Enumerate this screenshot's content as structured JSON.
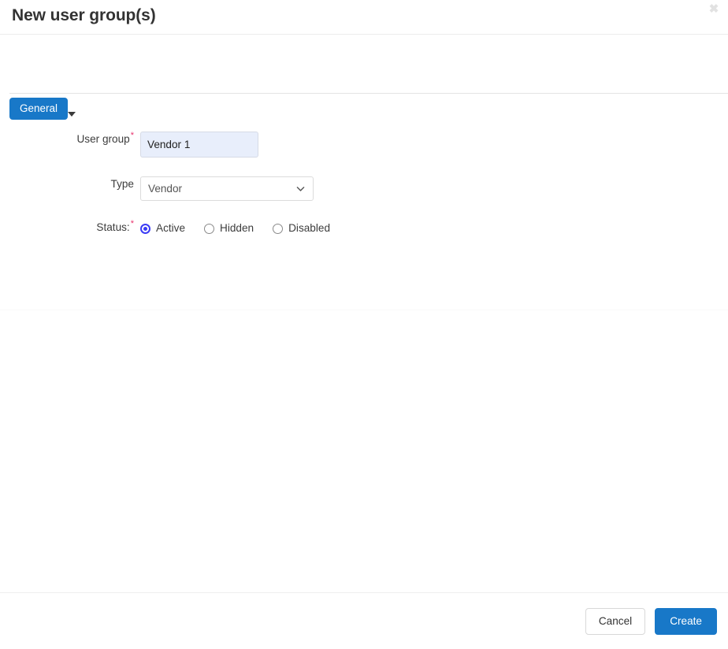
{
  "dialog": {
    "title": "New user group(s)",
    "close_label": "✖"
  },
  "tabs": [
    {
      "label": "General",
      "active": true
    }
  ],
  "section": {
    "title": "General",
    "collapsed": false
  },
  "form": {
    "fields": [
      {
        "label": "User group",
        "required": true,
        "required_mark": "*",
        "type": "text",
        "value": "Vendor 1",
        "placeholder": ""
      },
      {
        "label": "Type",
        "required": false,
        "required_mark": "",
        "type": "select",
        "value": "Vendor",
        "options": [
          "Vendor"
        ]
      },
      {
        "label": "Status:",
        "required": true,
        "required_mark": "*",
        "type": "radio",
        "value": "Active",
        "options": [
          "Active",
          "Hidden",
          "Disabled"
        ]
      }
    ]
  },
  "footer": {
    "cancel_label": "Cancel",
    "create_label": "Create"
  },
  "colors": {
    "accent": "#1878c8",
    "required": "#e8336d",
    "radio_selected": "#3b3bf5",
    "input_filled_bg": "#e8eefb"
  }
}
